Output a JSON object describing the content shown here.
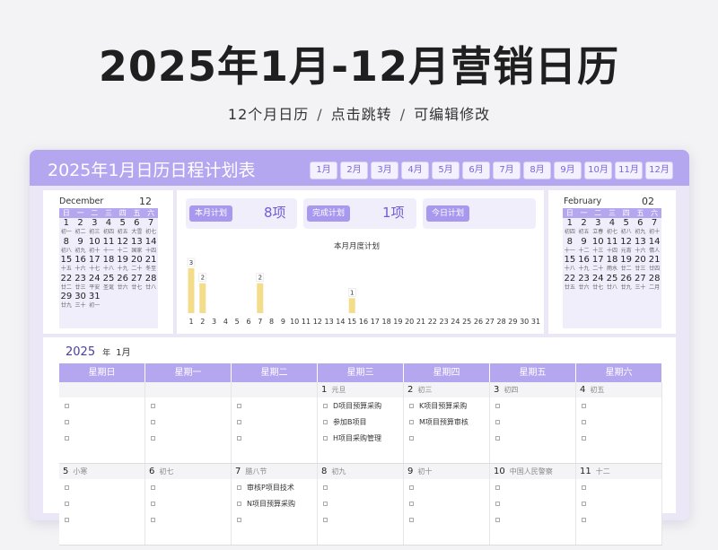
{
  "banner": {
    "title": "2025年1月-12月营销日历",
    "features": [
      "12个月日历",
      "点击跳转",
      "可编辑修改"
    ],
    "separator": "/"
  },
  "calendar": {
    "title": "2025年1月日历日程计划表",
    "month_tabs": [
      "1月",
      "2月",
      "3月",
      "4月",
      "5月",
      "6月",
      "7月",
      "8月",
      "9月",
      "10月",
      "11月",
      "12月"
    ],
    "weekday_short": [
      "日",
      "一",
      "二",
      "三",
      "四",
      "五",
      "六"
    ],
    "weekdays": [
      "星期日",
      "星期一",
      "星期二",
      "星期三",
      "星期四",
      "星期五",
      "星期六"
    ]
  },
  "prev_month": {
    "name": "December",
    "num": "12",
    "days": [
      [
        "1",
        "初一"
      ],
      [
        "2",
        "初二"
      ],
      [
        "3",
        "初三"
      ],
      [
        "4",
        "初四"
      ],
      [
        "5",
        "初五"
      ],
      [
        "6",
        "大雪"
      ],
      [
        "7",
        "初七"
      ],
      [
        "8",
        "初八"
      ],
      [
        "9",
        "初九"
      ],
      [
        "10",
        "初十"
      ],
      [
        "11",
        "十一"
      ],
      [
        "12",
        "十二"
      ],
      [
        "13",
        "国家"
      ],
      [
        "14",
        "十四"
      ],
      [
        "15",
        "十五"
      ],
      [
        "16",
        "十六"
      ],
      [
        "17",
        "十七"
      ],
      [
        "18",
        "十八"
      ],
      [
        "19",
        "十九"
      ],
      [
        "20",
        "二十"
      ],
      [
        "21",
        "冬至"
      ],
      [
        "22",
        "廿二"
      ],
      [
        "23",
        "廿三"
      ],
      [
        "24",
        "平安"
      ],
      [
        "25",
        "圣诞"
      ],
      [
        "26",
        "廿六"
      ],
      [
        "27",
        "廿七"
      ],
      [
        "28",
        "廿八"
      ],
      [
        "29",
        "廿九"
      ],
      [
        "30",
        "三十"
      ],
      [
        "31",
        "初一"
      ]
    ]
  },
  "next_month": {
    "name": "February",
    "num": "02",
    "days": [
      [
        "1",
        "初四"
      ],
      [
        "2",
        "初五"
      ],
      [
        "3",
        "立春"
      ],
      [
        "4",
        "初七"
      ],
      [
        "5",
        "初八"
      ],
      [
        "6",
        "初九"
      ],
      [
        "7",
        "初十"
      ],
      [
        "8",
        "十一"
      ],
      [
        "9",
        "十二"
      ],
      [
        "10",
        "十三"
      ],
      [
        "11",
        "十四"
      ],
      [
        "12",
        "元宵"
      ],
      [
        "13",
        "十六"
      ],
      [
        "14",
        "情人"
      ],
      [
        "15",
        "十八"
      ],
      [
        "16",
        "十九"
      ],
      [
        "17",
        "二十"
      ],
      [
        "18",
        "雨水"
      ],
      [
        "19",
        "廿二"
      ],
      [
        "20",
        "廿三"
      ],
      [
        "21",
        "廿四"
      ],
      [
        "22",
        "廿五"
      ],
      [
        "23",
        "廿六"
      ],
      [
        "24",
        "廿七"
      ],
      [
        "25",
        "廿八"
      ],
      [
        "26",
        "廿九"
      ],
      [
        "27",
        "三十"
      ],
      [
        "28",
        "二月"
      ]
    ]
  },
  "stats": {
    "month_plan_label": "本月计划",
    "month_plan_value": "8项",
    "done_label": "完成计划",
    "done_value": "1项",
    "today_label": "今日计划",
    "today_value": ""
  },
  "chart_data": {
    "type": "bar",
    "title": "本月月度计划",
    "categories": [
      "1",
      "2",
      "3",
      "4",
      "5",
      "6",
      "7",
      "8",
      "9",
      "10",
      "11",
      "12",
      "13",
      "14",
      "15",
      "16",
      "17",
      "18",
      "19",
      "20",
      "21",
      "22",
      "23",
      "24",
      "25",
      "26",
      "27",
      "28",
      "29",
      "30",
      "31"
    ],
    "values": [
      3,
      2,
      0,
      0,
      0,
      0,
      2,
      0,
      0,
      0,
      0,
      0,
      0,
      0,
      1,
      0,
      0,
      0,
      0,
      0,
      0,
      0,
      0,
      0,
      0,
      0,
      0,
      0,
      0,
      0,
      0
    ],
    "bar_color": "#f3dc8a",
    "xlabel": "",
    "ylabel": ""
  },
  "main": {
    "year": "2025",
    "year_unit": "年",
    "month": "1月",
    "weeks": [
      [
        {
          "day": "",
          "lunar": "",
          "tasks": [
            "",
            "",
            ""
          ]
        },
        {
          "day": "",
          "lunar": "",
          "tasks": [
            "",
            "",
            ""
          ]
        },
        {
          "day": "",
          "lunar": "",
          "tasks": [
            "",
            "",
            ""
          ]
        },
        {
          "day": "1",
          "lunar": "元旦",
          "tasks": [
            "D项目预算采购",
            "参加B项目",
            "H项目采购管理"
          ]
        },
        {
          "day": "2",
          "lunar": "初三",
          "tasks": [
            "K项目预算采购",
            "M项目预算审核",
            ""
          ]
        },
        {
          "day": "3",
          "lunar": "初四",
          "tasks": [
            "",
            "",
            ""
          ]
        },
        {
          "day": "4",
          "lunar": "初五",
          "tasks": [
            "",
            "",
            ""
          ]
        }
      ],
      [
        {
          "day": "5",
          "lunar": "小寒",
          "tasks": [
            "",
            "",
            ""
          ]
        },
        {
          "day": "6",
          "lunar": "初七",
          "tasks": [
            "",
            "",
            ""
          ]
        },
        {
          "day": "7",
          "lunar": "腊八节",
          "tasks": [
            "审核P项目技术",
            "N项目预算采购",
            ""
          ]
        },
        {
          "day": "8",
          "lunar": "初九",
          "tasks": [
            "",
            "",
            ""
          ]
        },
        {
          "day": "9",
          "lunar": "初十",
          "tasks": [
            "",
            "",
            ""
          ]
        },
        {
          "day": "10",
          "lunar": "中国人民警察",
          "tasks": [
            "",
            "",
            ""
          ]
        },
        {
          "day": "11",
          "lunar": "十二",
          "tasks": [
            "",
            "",
            ""
          ]
        }
      ]
    ]
  }
}
